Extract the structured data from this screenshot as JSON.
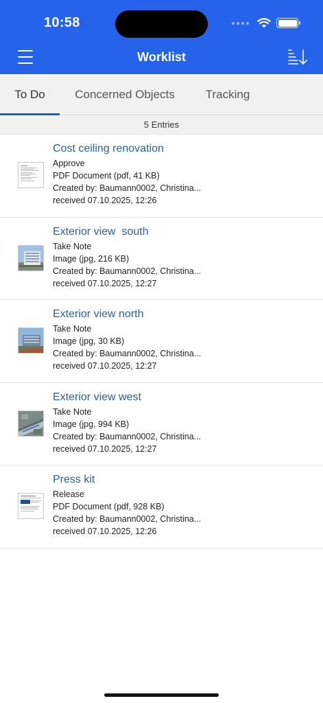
{
  "status": {
    "time": "10:58"
  },
  "header": {
    "title": "Worklist"
  },
  "tabs": [
    {
      "label": "To Do",
      "active": true
    },
    {
      "label": "Concerned Objects",
      "active": false
    },
    {
      "label": "Tracking",
      "active": false
    }
  ],
  "entries_label": "5 Entries",
  "items": [
    {
      "title": "Cost ceiling renovation",
      "action": "Approve",
      "file": "PDF Document (pdf, 41 KB)",
      "created": "Created by: Baumann0002, Christina...",
      "received": "received 07.10.2025, 12:26",
      "thumb": "pdf-document-thumbnail"
    },
    {
      "title": "Exterior view  south",
      "action": "Take Note",
      "file": "Image (jpg, 216 KB)",
      "created": "Created by: Baumann0002, Christina...",
      "received": "received 07.10.2025, 12:27",
      "thumb": "building-photo-thumbnail"
    },
    {
      "title": "Exterior view north",
      "action": "Take Note",
      "file": "Image (jpg, 30 KB)",
      "created": "Created by: Baumann0002, Christina...",
      "received": "received 07.10.2025, 12:27",
      "thumb": "building-photo-thumbnail"
    },
    {
      "title": "Exterior view west",
      "action": "Take Note",
      "file": "Image (jpg, 994 KB)",
      "created": "Created by: Baumann0002, Christina...",
      "received": "received 07.10.2025, 12:27",
      "thumb": "aerial-photo-thumbnail"
    },
    {
      "title": "Press kit",
      "action": "Release",
      "file": "PDF Document (pdf, 928 KB)",
      "created": "Created by: Baumann0002, Christina...",
      "received": "received 07.10.2025, 12:26",
      "thumb": "pdf-document-thumbnail"
    }
  ],
  "colors": {
    "header": "#2563ea",
    "accent": "#1b5fb0",
    "title_text": "#2e5f8f"
  }
}
